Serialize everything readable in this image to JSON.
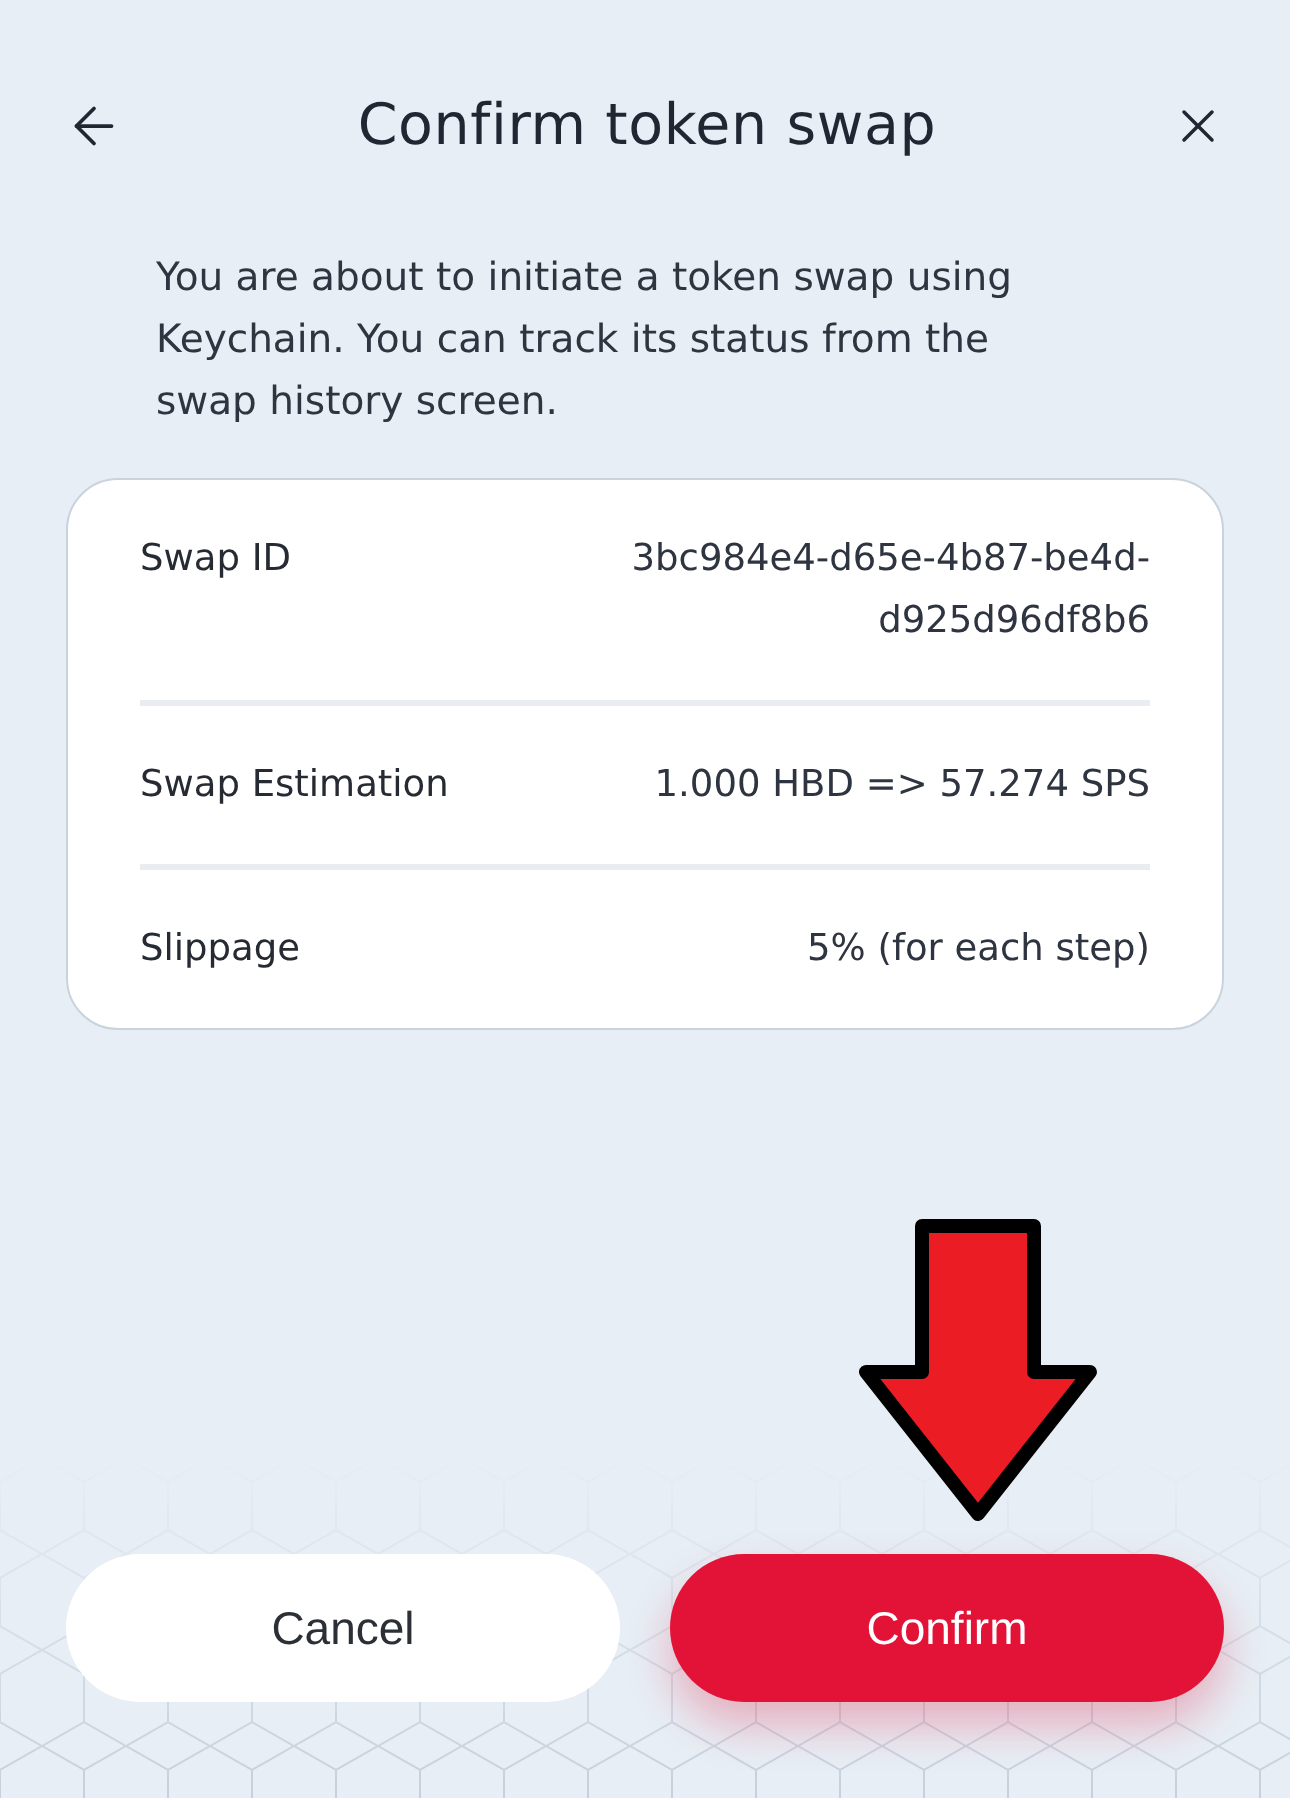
{
  "header": {
    "title": "Confirm token swap"
  },
  "description": "You are about to initiate a token swap using Keychain. You can track its status from the swap history screen.",
  "details": [
    {
      "label": "Swap ID",
      "value": "3bc984e4-d65e-4b87-be4d-d925d96df8b6"
    },
    {
      "label": "Swap Estimation",
      "value": "1.000 HBD => 57.274 SPS"
    },
    {
      "label": "Slippage",
      "value": "5% (for each step)"
    }
  ],
  "buttons": [
    {
      "label": "Cancel",
      "kind": "secondary"
    },
    {
      "label": "Confirm",
      "kind": "primary"
    }
  ]
}
